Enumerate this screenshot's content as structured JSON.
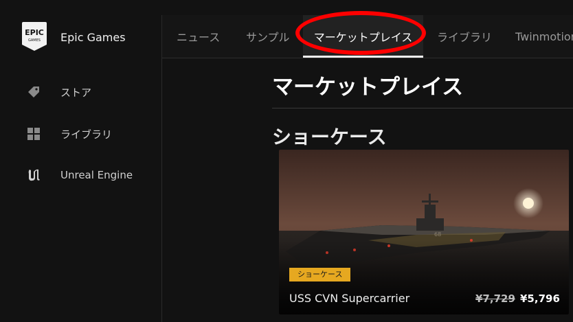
{
  "brand": {
    "name": "Epic Games",
    "logo_text_top": "EPIC",
    "logo_text_bottom": "GAMES"
  },
  "sidebar": {
    "items": [
      {
        "label": "ストア",
        "icon": "tag-icon"
      },
      {
        "label": "ライブラリ",
        "icon": "grid-icon"
      },
      {
        "label": "Unreal Engine",
        "icon": "unreal-logo-icon"
      }
    ]
  },
  "topnav": {
    "tabs": [
      {
        "label": "ニュース",
        "active": false
      },
      {
        "label": "サンプル",
        "active": false
      },
      {
        "label": "マーケットプレイス",
        "active": true
      },
      {
        "label": "ライブラリ",
        "active": false
      },
      {
        "label": "Twinmotion",
        "active": false
      }
    ]
  },
  "main": {
    "title": "マーケットプレイス",
    "section_title": "ショーケース",
    "showcase": {
      "badge": "ショーケース",
      "product_name": "USS CVN Supercarrier",
      "original_price": "¥7,729",
      "sale_price": "¥5,796"
    }
  },
  "colors": {
    "accent_badge": "#e6a820",
    "highlight_ring": "#ff0000",
    "background": "#121212"
  }
}
